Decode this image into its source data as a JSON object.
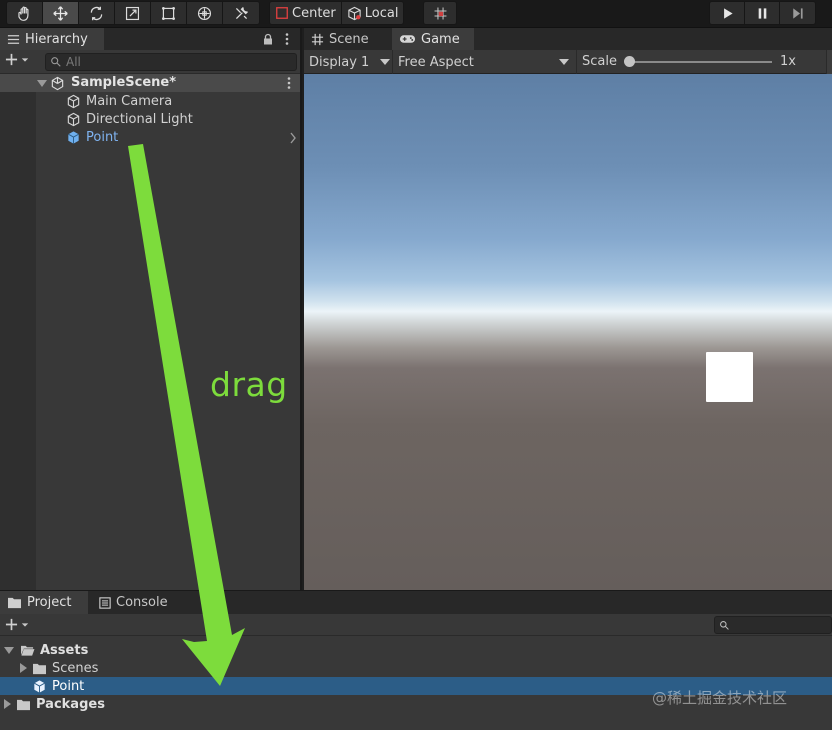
{
  "toolbar": {
    "tools": [
      {
        "name": "hand-tool-icon",
        "active": false
      },
      {
        "name": "move-tool-icon",
        "active": true
      },
      {
        "name": "rotate-tool-icon",
        "active": false
      },
      {
        "name": "scale-tool-icon",
        "active": false
      },
      {
        "name": "rect-tool-icon",
        "active": false
      },
      {
        "name": "transform-tool-icon",
        "active": false
      },
      {
        "name": "custom-tool-icon",
        "active": false
      }
    ],
    "pivot_label": "Center",
    "space_label": "Local",
    "snap_icon": "grid-snap-icon",
    "playback": [
      "play-icon",
      "pause-icon",
      "step-icon"
    ]
  },
  "hierarchy": {
    "tab_label": "Hierarchy",
    "search_placeholder": "All",
    "scene_name": "SampleScene*",
    "items": [
      {
        "label": "Main Camera",
        "icon": "gameobject-icon",
        "selected": false
      },
      {
        "label": "Directional Light",
        "icon": "gameobject-icon",
        "selected": false
      },
      {
        "label": "Point",
        "icon": "prefab-icon",
        "selected": false
      }
    ]
  },
  "game": {
    "tabs": [
      {
        "label": "Scene",
        "icon": "scene-grid-icon",
        "active": false
      },
      {
        "label": "Game",
        "icon": "gamepad-icon",
        "active": true
      }
    ],
    "display": "Display 1",
    "aspect": "Free Aspect",
    "scale_label": "Scale",
    "scale_value": "1x",
    "scale_fraction": 0.0
  },
  "project": {
    "tabs": [
      {
        "label": "Project",
        "icon": "folder-icon",
        "active": true
      },
      {
        "label": "Console",
        "icon": "console-icon",
        "active": false
      }
    ],
    "tree": [
      {
        "label": "Assets",
        "bold": true,
        "expanded": true,
        "depth": 0
      },
      {
        "label": "Scenes",
        "bold": false,
        "expanded": false,
        "depth": 1
      },
      {
        "label": "Point",
        "bold": false,
        "depth": 1,
        "selected": true,
        "prefab": true
      },
      {
        "label": "Packages",
        "bold": true,
        "expanded": false,
        "depth": 0
      }
    ]
  },
  "annotation": {
    "text": "drag",
    "color": "#7ddc3c"
  },
  "watermark": "@稀土掘金技术社区",
  "colors": {
    "selection": "#2c5d87",
    "prefab_text": "#7fb3f0",
    "cube": "#ffffff"
  }
}
